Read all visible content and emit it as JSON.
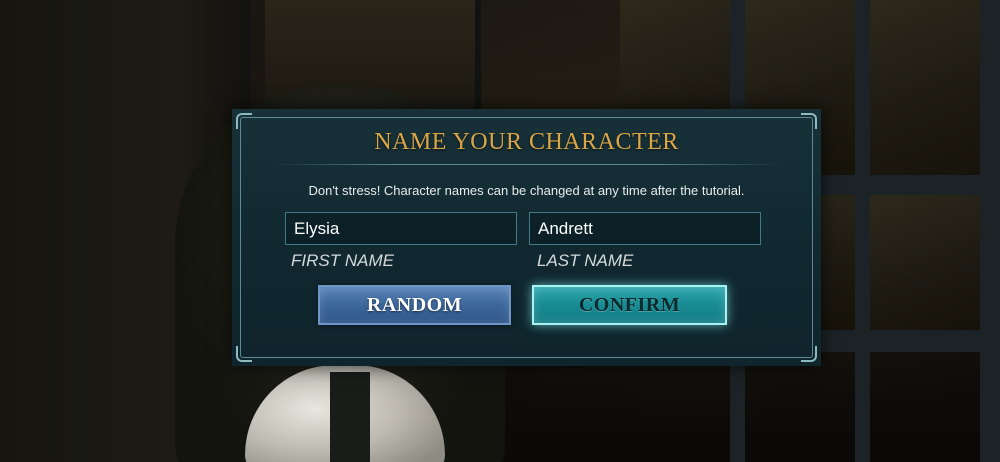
{
  "dialog": {
    "title": "NAME YOUR CHARACTER",
    "subtitle": "Don't stress! Character names can be changed at any time after the tutorial.",
    "first_name": {
      "value": "Elysia",
      "label": "FIRST NAME"
    },
    "last_name": {
      "value": "Andrett",
      "label": "LAST NAME"
    },
    "buttons": {
      "random": "RANDOM",
      "confirm": "CONFIRM"
    }
  },
  "colors": {
    "title_gold": "#d9a647",
    "dialog_teal": "#112830",
    "border_teal": "#5d8a93",
    "random_blue": "#3f6a9f",
    "confirm_cyan": "#1a8d95"
  }
}
